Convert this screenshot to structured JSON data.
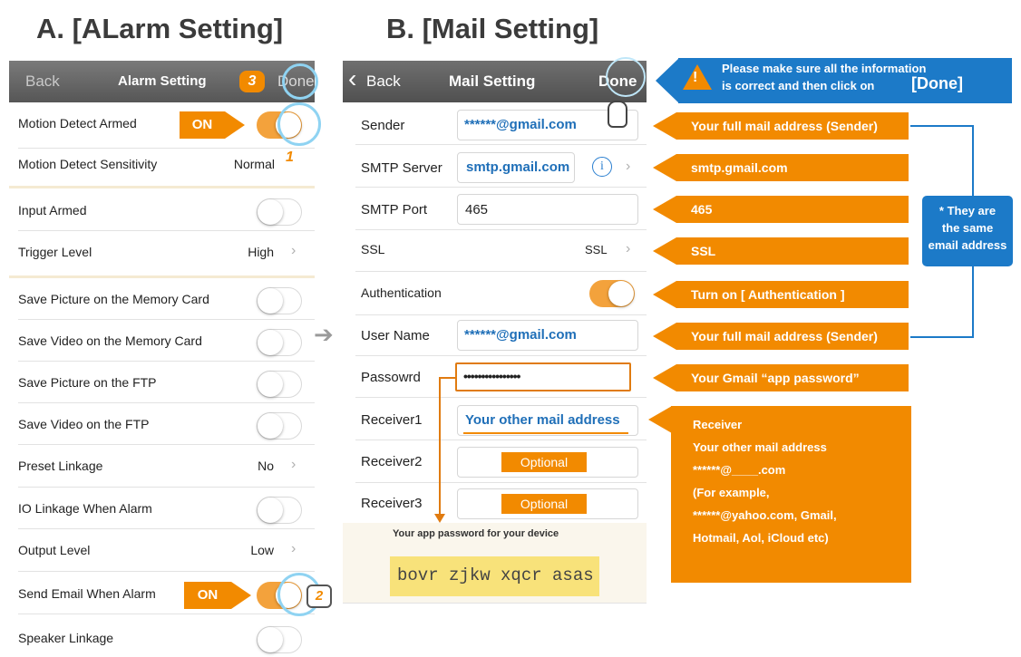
{
  "headings": {
    "alarm": "A. [ALarm Setting]",
    "mail": "B. [Mail Setting]"
  },
  "alarm_screen": {
    "nav": {
      "back": "Back",
      "title": "Alarm Setting",
      "done": "Done",
      "step": "3"
    },
    "rows": [
      {
        "label": "Motion Detect Armed",
        "type": "toggle",
        "on": true
      },
      {
        "label": "Motion Detect Sensitivity",
        "type": "value",
        "value": "Normal"
      },
      {
        "label": "Input Armed",
        "type": "toggle",
        "on": false
      },
      {
        "label": "Trigger Level",
        "type": "value",
        "value": "High",
        "chevron": "›"
      },
      {
        "label": "Save Picture on the Memory Card",
        "type": "toggle",
        "on": false
      },
      {
        "label": "Save Video on the Memory Card",
        "type": "toggle",
        "on": false
      },
      {
        "label": "Save Picture on the FTP",
        "type": "toggle",
        "on": false
      },
      {
        "label": "Save Video on the FTP",
        "type": "toggle",
        "on": false
      },
      {
        "label": "Preset Linkage",
        "type": "value",
        "value": "No",
        "chevron": "›"
      },
      {
        "label": "IO Linkage When Alarm",
        "type": "toggle",
        "on": false
      },
      {
        "label": "Output Level",
        "type": "value",
        "value": "Low",
        "chevron": "›"
      },
      {
        "label": "Send Email When Alarm",
        "type": "toggle",
        "on": true
      },
      {
        "label": "Speaker Linkage",
        "type": "toggle",
        "on": false
      }
    ],
    "on_tag_1": "ON",
    "on_tag_2": "ON",
    "step_1": "1",
    "step_2": "2"
  },
  "mail_screen": {
    "nav": {
      "back_chevron": "‹",
      "back": "Back",
      "title": "Mail Setting",
      "done": "Done"
    },
    "rows": {
      "sender": {
        "label": "Sender",
        "value": "******@gmail.com"
      },
      "smtp_server": {
        "label": "SMTP Server",
        "value": "smtp.gmail.com",
        "info": "i",
        "chevron": "›"
      },
      "smtp_port": {
        "label": "SMTP Port",
        "value": "465"
      },
      "ssl": {
        "label": "SSL",
        "value": "SSL",
        "chevron": "›"
      },
      "authentication": {
        "label": "Authentication"
      },
      "user_name": {
        "label": "User Name",
        "value": "******@gmail.com"
      },
      "password": {
        "label": "Passowrd",
        "value": "••••••••••••••••"
      },
      "receiver1": {
        "label": "Receiver1",
        "value": "Your other mail address"
      },
      "receiver2": {
        "label": "Receiver2",
        "value": "Optional"
      },
      "receiver3": {
        "label": "Receiver3",
        "value": "Optional"
      }
    },
    "app_password": {
      "caption": "Your app password for your device",
      "code": "bovr zjkw xqcr asas"
    }
  },
  "banner": {
    "warning_symbol": "!",
    "line1": "Please make sure all the information",
    "line2": "is correct and then click on",
    "done": "[Done]"
  },
  "callouts": {
    "sender": "Your full mail address (Sender)",
    "smtp_server": "smtp.gmail.com",
    "smtp_port": "465",
    "ssl": "SSL",
    "authentication": "Turn on [ Authentication ]",
    "user_name": "Your full mail address (Sender)",
    "password": "Your Gmail “app password”",
    "receiver": [
      "Receiver",
      "Your other mail address",
      "******@____.com",
      "(For example,",
      "******@yahoo.com, Gmail,",
      "Hotmail, Aol, iCloud etc)"
    ],
    "same": [
      "* They are",
      "the same",
      "email address"
    ]
  },
  "arrow_glyph": "➔",
  "colors": {
    "orange": "#f28a00",
    "blue": "#1f6fb8",
    "toggle_on": "#f3a23c",
    "navbar": "#666666",
    "banner": "#1c7ac8"
  }
}
